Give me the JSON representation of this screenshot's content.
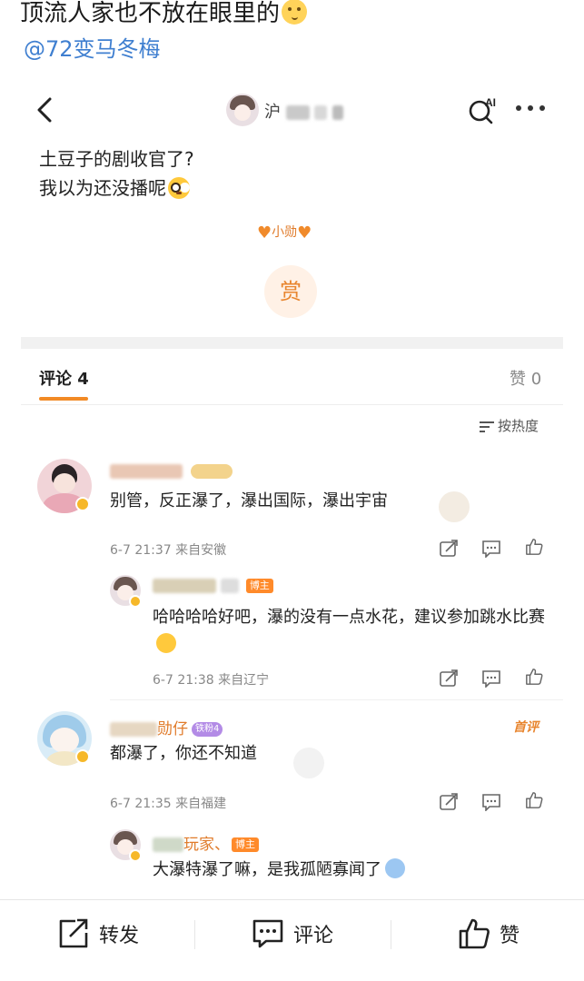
{
  "caption": {
    "text": "顶流人家也不放在眼里的",
    "emoji": "shushing-face",
    "mention": "@72变马冬梅"
  },
  "topbar": {
    "name_prefix": "沪",
    "icons": [
      "back-arrow-icon",
      "ai-search-icon",
      "more-icon"
    ]
  },
  "post": {
    "lines": [
      "土豆子的剧收官了?",
      "我以为还没播呢"
    ],
    "emoji": "flushed-face"
  },
  "reward": {
    "name": "小勋",
    "button_label": "赏"
  },
  "tabs": {
    "comments": "评论 4",
    "likes": "赞 0"
  },
  "sort": {
    "label": "按热度"
  },
  "comments": [
    {
      "text": "别管，反正瀑了，瀑出国际，瀑出宇宙",
      "time": "6-7 21:37",
      "location": "来自安徽",
      "reply": {
        "badge": "博主",
        "text": "哈哈哈哈好吧，瀑的没有一点水花，建议参加跳水比赛",
        "time": "6-7 21:38",
        "location": "来自辽宁"
      }
    },
    {
      "nickname_suffix": "勋仔",
      "fan_badge": "铁粉4",
      "tag": "首评",
      "text": "都瀑了，你还不知道",
      "time": "6-7 21:35",
      "location": "来自福建",
      "reply": {
        "nickname_suffix": "玩家、",
        "badge": "博主",
        "text": "大瀑特瀑了嘛，是我孤陋寡闻了"
      }
    }
  ],
  "bottom_bar": {
    "repost": "转发",
    "comment": "评论",
    "like": "赞"
  },
  "colors": {
    "accent": "#f28a25",
    "mention": "#3f7fd0",
    "nickname": "#e07b2a",
    "meta": "#888888"
  }
}
